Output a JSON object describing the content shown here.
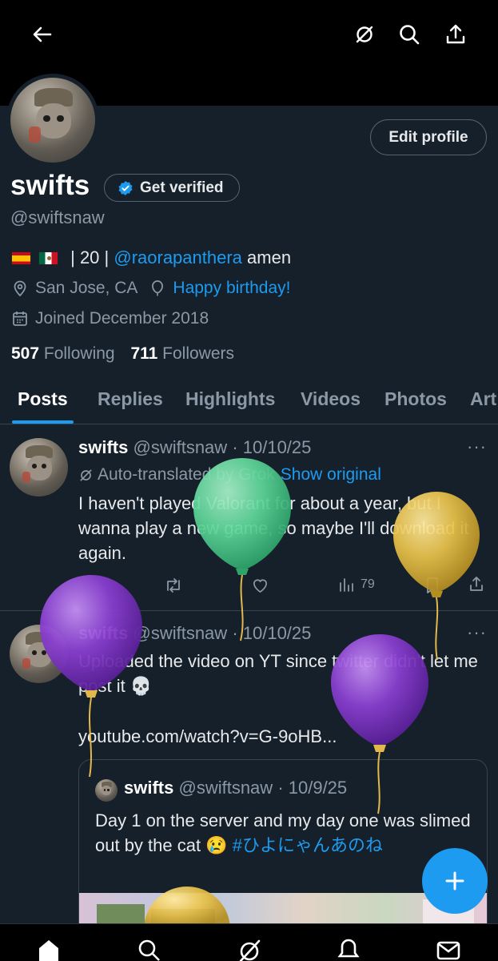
{
  "header": {
    "icons": [
      "back-arrow-icon",
      "grok-icon",
      "search-icon",
      "share-icon"
    ]
  },
  "profile": {
    "edit_label": "Edit profile",
    "name": "swifts",
    "verify_label": "Get verified",
    "handle": "@swiftsnaw",
    "bio_middle": " | 20 | ",
    "bio_mention": "@raorapanthera",
    "bio_end": " amen",
    "location": "San Jose, CA",
    "birthday": "Happy birthday!",
    "joined": "Joined December 2018",
    "following_count": "507",
    "following_label": " Following",
    "followers_count": "711",
    "followers_label": " Followers"
  },
  "tabs": [
    "Posts",
    "Replies",
    "Highlights",
    "Videos",
    "Photos",
    "Art"
  ],
  "posts": [
    {
      "name": "swifts",
      "handle": "@swiftsnaw",
      "date": "· 10/10/25",
      "translated": "Auto-translated by Grok",
      "show_original": "Show original",
      "text": "I haven't played Valorant for about a year, but I wanna play a new game, so maybe I'll download it again.",
      "views": "79"
    },
    {
      "name": "swifts",
      "handle": "@swiftsnaw",
      "date": "· 10/10/25",
      "text": "Uploaded the video on YT since twitter didn't let me post it 💀",
      "link": "youtube.com/watch?v=G-9oHB..."
    }
  ],
  "quote": {
    "name": "swifts",
    "handle": "@swiftsnaw",
    "date": "· 10/9/25",
    "text": "Day 1 on the server and my day one was slimed out by the cat 😢 ",
    "hashtag": "#ひよにゃんあのね"
  },
  "colors": {
    "background": "#15202b",
    "accent": "#1d9bf0",
    "balloon_green": "#5fd69a",
    "balloon_yellow": "#e9c24a",
    "balloon_purple": "#8a3fd1"
  },
  "bottom_nav": [
    "home-icon",
    "search-icon",
    "grok-icon",
    "notifications-icon",
    "messages-icon"
  ]
}
